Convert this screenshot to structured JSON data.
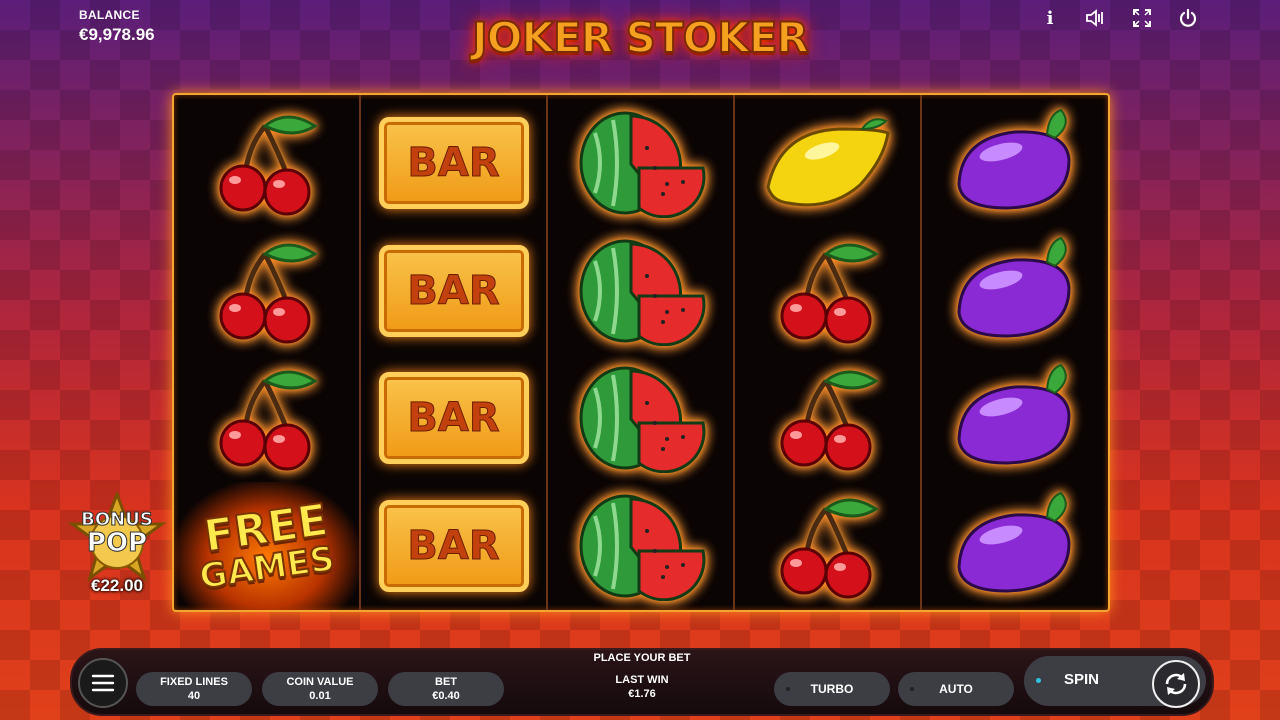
{
  "header": {
    "balance_label": "BALANCE",
    "balance_value": "€9,978.96",
    "logo_text": "JOKER STOKER",
    "icons": [
      "info-icon",
      "sound-icon",
      "fullscreen-icon",
      "power-icon"
    ],
    "info_glyph": "i"
  },
  "reels": [
    [
      "cherry",
      "cherry",
      "cherry",
      "free-games"
    ],
    [
      "bar",
      "bar",
      "bar",
      "bar"
    ],
    [
      "watermelon",
      "watermelon",
      "watermelon",
      "watermelon"
    ],
    [
      "lemon",
      "cherry",
      "cherry",
      "cherry"
    ],
    [
      "plum",
      "plum",
      "plum",
      "plum"
    ]
  ],
  "symbols": {
    "bar_label": "BAR",
    "free_games_line1": "FREE",
    "free_games_line2": "GAMES"
  },
  "bonus_pop": {
    "line1": "BONUS",
    "line2": "POP",
    "amount": "€22.00"
  },
  "bottom_bar": {
    "place_bet": "PLACE YOUR BET",
    "fixed_lines_label": "FIXED LINES",
    "fixed_lines_value": "40",
    "coin_value_label": "COIN VALUE",
    "coin_value_value": "0.01",
    "bet_label": "BET",
    "bet_value": "€0.40",
    "last_win_label": "LAST WIN",
    "last_win_value": "€1.76",
    "turbo_label": "TURBO",
    "auto_label": "AUTO",
    "spin_label": "SPIN"
  },
  "colors": {
    "frame": "#f3a531",
    "glow": "#ff7a12",
    "spin_indicator": "#31c4e3"
  }
}
